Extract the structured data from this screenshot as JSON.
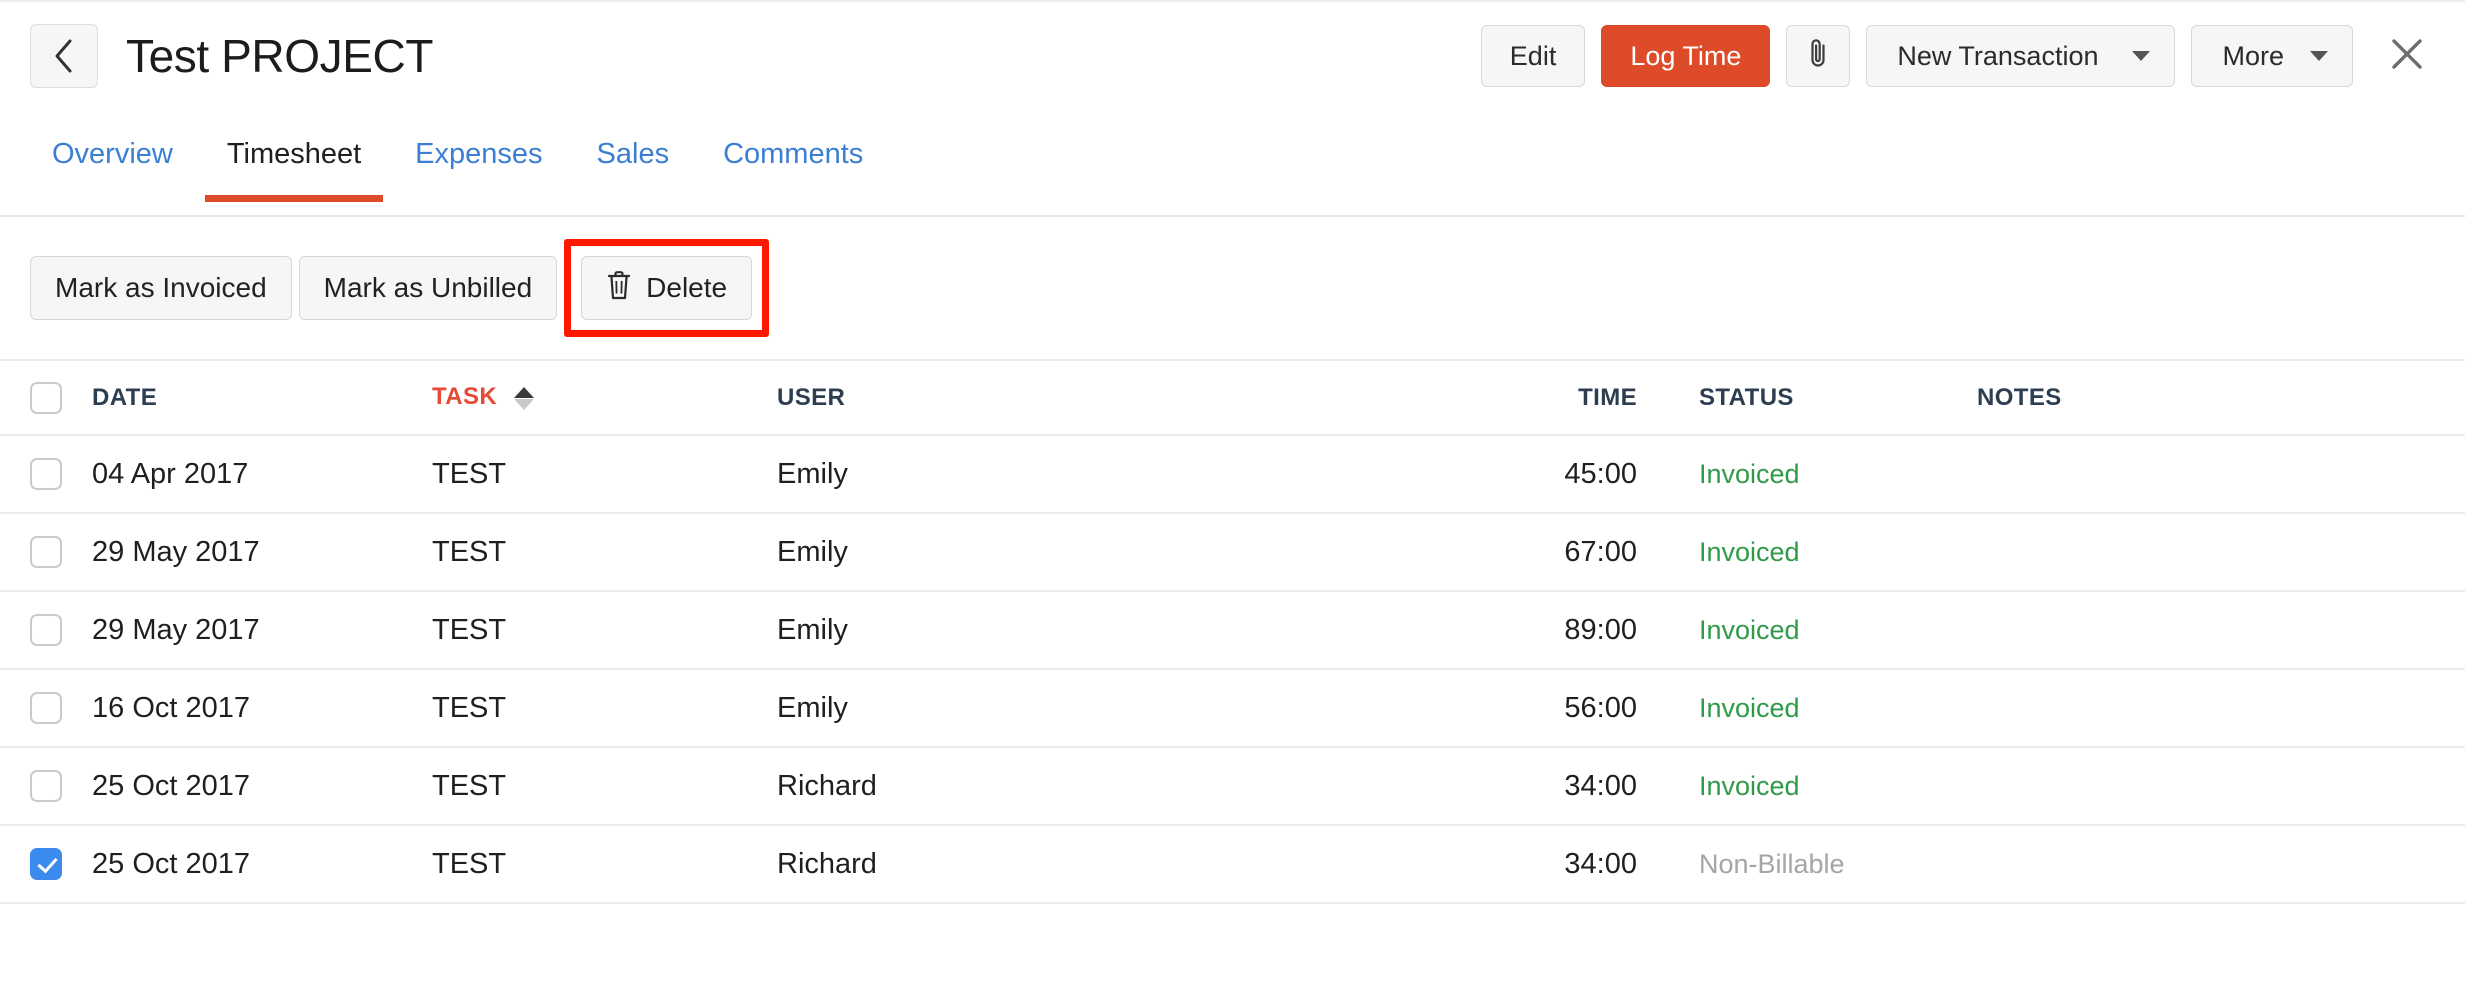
{
  "header": {
    "back_icon": "chevron-left-icon",
    "title": "Test PROJECT",
    "actions": {
      "edit_label": "Edit",
      "log_time_label": "Log Time",
      "attachment_icon": "paperclip-icon",
      "new_transaction_label": "New Transaction",
      "more_label": "More",
      "close_icon": "close-icon"
    },
    "accent_color": "#dd4b28"
  },
  "tabs": [
    {
      "label": "Overview",
      "active": false
    },
    {
      "label": "Timesheet",
      "active": true
    },
    {
      "label": "Expenses",
      "active": false
    },
    {
      "label": "Sales",
      "active": false
    },
    {
      "label": "Comments",
      "active": false
    }
  ],
  "toolbar": {
    "mark_invoiced_label": "Mark as Invoiced",
    "mark_unbilled_label": "Mark as Unbilled",
    "delete_label": "Delete",
    "delete_icon": "trash-icon",
    "highlight_color": "#ff1800"
  },
  "table": {
    "columns": [
      {
        "key": "date",
        "label": "DATE",
        "sorted": false
      },
      {
        "key": "task",
        "label": "TASK",
        "sorted": true,
        "sort_direction": "asc"
      },
      {
        "key": "user",
        "label": "USER",
        "sorted": false
      },
      {
        "key": "time",
        "label": "TIME",
        "sorted": false
      },
      {
        "key": "status",
        "label": "STATUS",
        "sorted": false
      },
      {
        "key": "notes",
        "label": "NOTES",
        "sorted": false
      }
    ],
    "select_all_checked": false,
    "rows": [
      {
        "selected": false,
        "date": "04 Apr 2017",
        "task": "TEST",
        "user": "Emily",
        "time": "45:00",
        "status": "Invoiced",
        "status_kind": "invoiced",
        "notes": ""
      },
      {
        "selected": false,
        "date": "29 May 2017",
        "task": "TEST",
        "user": "Emily",
        "time": "67:00",
        "status": "Invoiced",
        "status_kind": "invoiced",
        "notes": ""
      },
      {
        "selected": false,
        "date": "29 May 2017",
        "task": "TEST",
        "user": "Emily",
        "time": "89:00",
        "status": "Invoiced",
        "status_kind": "invoiced",
        "notes": ""
      },
      {
        "selected": false,
        "date": "16 Oct 2017",
        "task": "TEST",
        "user": "Emily",
        "time": "56:00",
        "status": "Invoiced",
        "status_kind": "invoiced",
        "notes": ""
      },
      {
        "selected": false,
        "date": "25 Oct 2017",
        "task": "TEST",
        "user": "Richard",
        "time": "34:00",
        "status": "Invoiced",
        "status_kind": "invoiced",
        "notes": ""
      },
      {
        "selected": true,
        "date": "25 Oct 2017",
        "task": "TEST",
        "user": "Richard",
        "time": "34:00",
        "status": "Non-Billable",
        "status_kind": "nonbillable",
        "notes": ""
      }
    ]
  },
  "colors": {
    "accent": "#dd4b28",
    "link": "#3b7fd4",
    "checkbox_checked": "#3b8bef",
    "status_invoiced": "#2f9b49",
    "status_nonbillable": "#a3a6a8",
    "highlight": "#ff1800"
  }
}
